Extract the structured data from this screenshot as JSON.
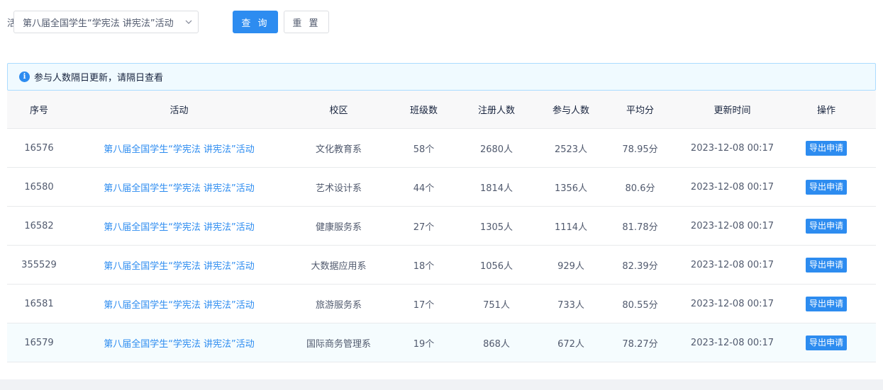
{
  "filter": {
    "label": "活动",
    "select_value": "第八届全国学生“学宪法 讲宪法”活动",
    "query_label": "查 询",
    "reset_label": "重 置"
  },
  "notice": {
    "text": "参与人数隔日更新，请隔日查看",
    "icon": "info-icon"
  },
  "table": {
    "headers": [
      "序号",
      "活动",
      "校区",
      "班级数",
      "注册人数",
      "参与人数",
      "平均分",
      "更新时间",
      "操作"
    ],
    "rows": [
      {
        "id": "16576",
        "activity": "第八届全国学生“学宪法 讲宪法”活动",
        "campus": "文化教育系",
        "classes": "58个",
        "registered": "2680人",
        "participants": "2523人",
        "avg": "78.95分",
        "updated": "2023-12-08 00:17",
        "action": "导出申请"
      },
      {
        "id": "16580",
        "activity": "第八届全国学生“学宪法 讲宪法”活动",
        "campus": "艺术设计系",
        "classes": "44个",
        "registered": "1814人",
        "participants": "1356人",
        "avg": "80.6分",
        "updated": "2023-12-08 00:17",
        "action": "导出申请"
      },
      {
        "id": "16582",
        "activity": "第八届全国学生“学宪法 讲宪法”活动",
        "campus": "健康服务系",
        "classes": "27个",
        "registered": "1305人",
        "participants": "1114人",
        "avg": "81.78分",
        "updated": "2023-12-08 00:17",
        "action": "导出申请"
      },
      {
        "id": "355529",
        "activity": "第八届全国学生“学宪法 讲宪法”活动",
        "campus": "大数据应用系",
        "classes": "18个",
        "registered": "1056人",
        "participants": "929人",
        "avg": "82.39分",
        "updated": "2023-12-08 00:17",
        "action": "导出申请"
      },
      {
        "id": "16581",
        "activity": "第八届全国学生“学宪法 讲宪法”活动",
        "campus": "旅游服务系",
        "classes": "17个",
        "registered": "751人",
        "participants": "733人",
        "avg": "80.55分",
        "updated": "2023-12-08 00:17",
        "action": "导出申请"
      },
      {
        "id": "16579",
        "activity": "第八届全国学生“学宪法 讲宪法”活动",
        "campus": "国际商务管理系",
        "classes": "19个",
        "registered": "868人",
        "participants": "672人",
        "avg": "78.27分",
        "updated": "2023-12-08 00:17",
        "action": "导出申请"
      }
    ]
  },
  "colors": {
    "primary": "#2d8cf0",
    "notice_bg": "#f0faff",
    "notice_border": "#abdcff",
    "header_bg": "#f8f8f9"
  }
}
